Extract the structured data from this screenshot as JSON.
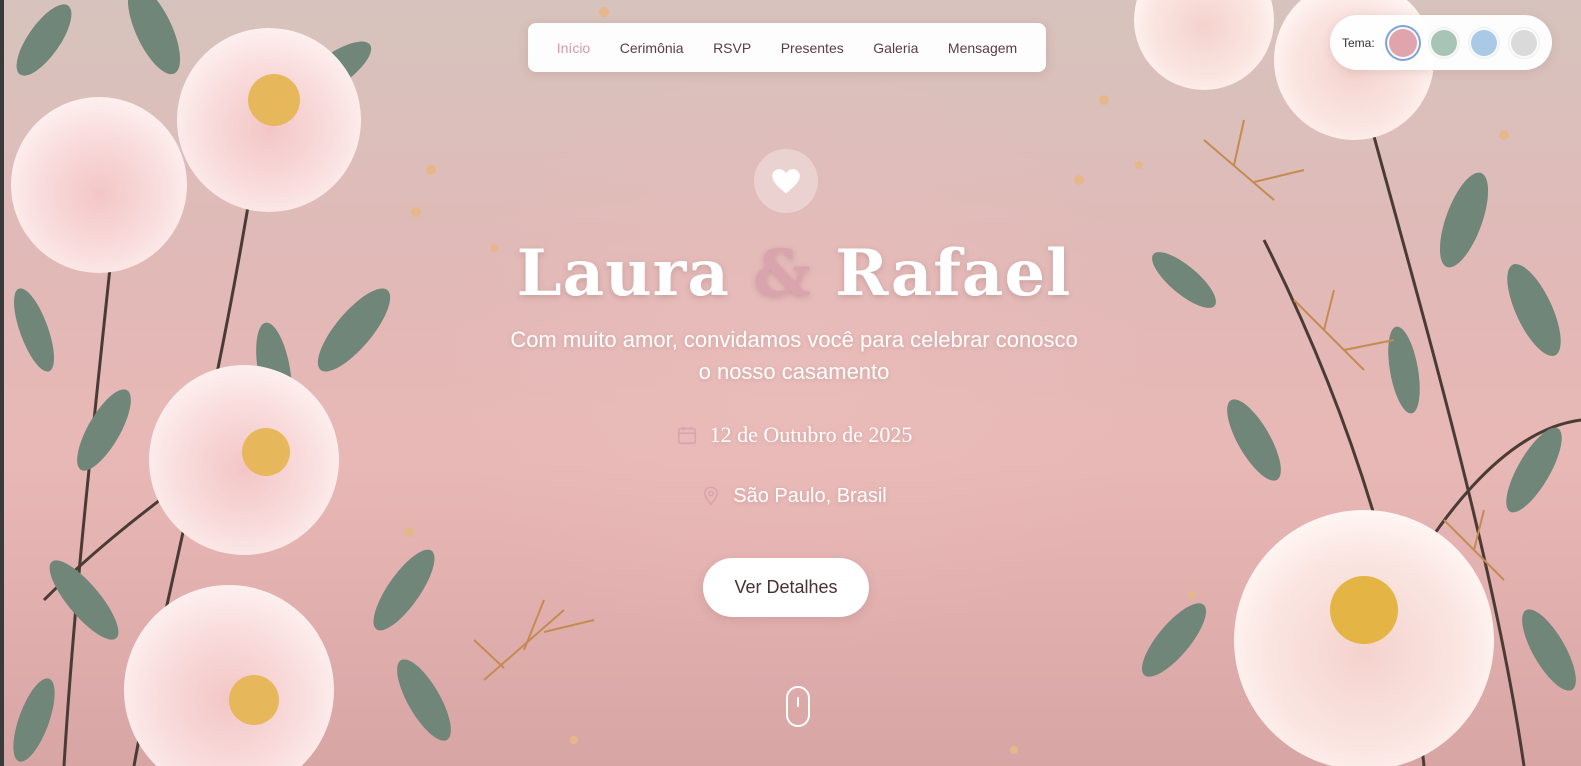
{
  "nav": {
    "items": [
      {
        "label": "Início",
        "active": true
      },
      {
        "label": "Cerimônia"
      },
      {
        "label": "RSVP"
      },
      {
        "label": "Presentes"
      },
      {
        "label": "Galeria"
      },
      {
        "label": "Mensagem"
      }
    ]
  },
  "theme": {
    "label": "Tema:",
    "swatches": [
      {
        "name": "rose",
        "color": "#dfa4ac",
        "selected": true
      },
      {
        "name": "sage",
        "color": "#a7c4b7"
      },
      {
        "name": "sky",
        "color": "#a9c9e6"
      },
      {
        "name": "gray",
        "color": "#dadada"
      }
    ]
  },
  "hero": {
    "icon": "heart-icon",
    "name1": "Laura",
    "amp": "&",
    "name2": "Rafael",
    "subtitle_line1": "Com muito amor, convidamos você para celebrar conosco",
    "subtitle_line2": "o nosso casamento",
    "date": "12 de Outubro de 2025",
    "date_icon": "calendar-icon",
    "location": "São Paulo, Brasil",
    "location_icon": "map-pin-icon",
    "cta_label": "Ver Detalhes",
    "scroll_icon": "mouse-scroll-icon"
  },
  "colors": {
    "accent": "#d9a4ad",
    "text_dark": "#4a2f33",
    "background": "#e8b8b6"
  }
}
